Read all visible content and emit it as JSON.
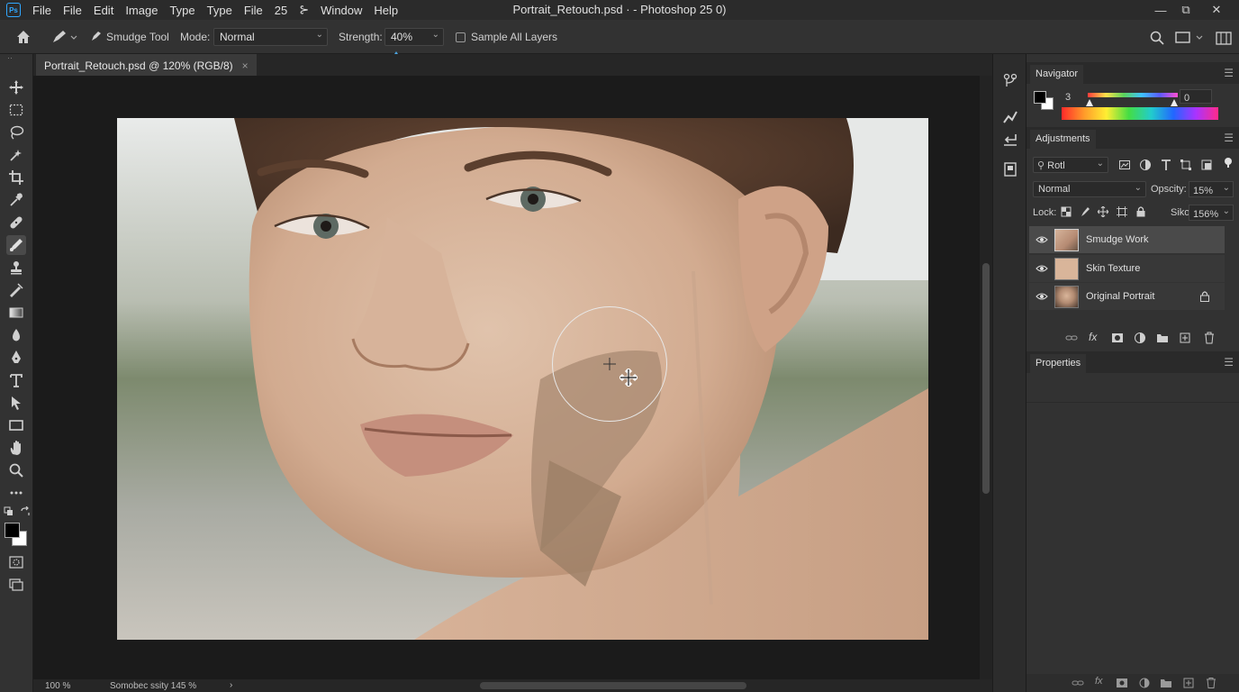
{
  "app": {
    "logo": "Ps",
    "window_title": "Portrait_Retouch.psd · - Photoshop 25 0)",
    "menu": [
      "File",
      "File",
      "Edit",
      "Image",
      "Type",
      "Type",
      "File",
      "25",
      "⊱",
      "Window",
      "Help"
    ]
  },
  "options": {
    "tool_name": "Smudge Tool",
    "mode_label": "Mode:",
    "mode_value": "Normal",
    "strength_label": "Strength:",
    "strength_value": "40%",
    "sample_all_layers_label": "Sample All Layers",
    "sample_all_layers_checked": false
  },
  "document": {
    "tab_title": "Portrait_Retouch.psd @ 120% (RGB/8)",
    "tab_close": "×"
  },
  "status": {
    "zoom": "100 %",
    "info": "Somobec ssity 145 %",
    "arrow": "›"
  },
  "navigator": {
    "title": "Navigator",
    "value_left": "3",
    "value_right": "0"
  },
  "adjustments": {
    "title": "Adjustments",
    "filter_kind": "Rotl",
    "blend_mode": "Normal",
    "opacity_label": "Opscity:",
    "opacity_value": "15%",
    "lock_label": "Lock:",
    "fill_label": "Siko:",
    "fill_value": "156%"
  },
  "layers": [
    {
      "name": "Smudge Work",
      "selected": true,
      "locked": false
    },
    {
      "name": "Skin Texture",
      "selected": false,
      "locked": false
    },
    {
      "name": "Original Portrait",
      "selected": false,
      "locked": true
    }
  ],
  "properties": {
    "title": "Properties"
  },
  "colors": {
    "accent": "#31a8ff",
    "foreground": "#000000",
    "background": "#ffffff"
  }
}
